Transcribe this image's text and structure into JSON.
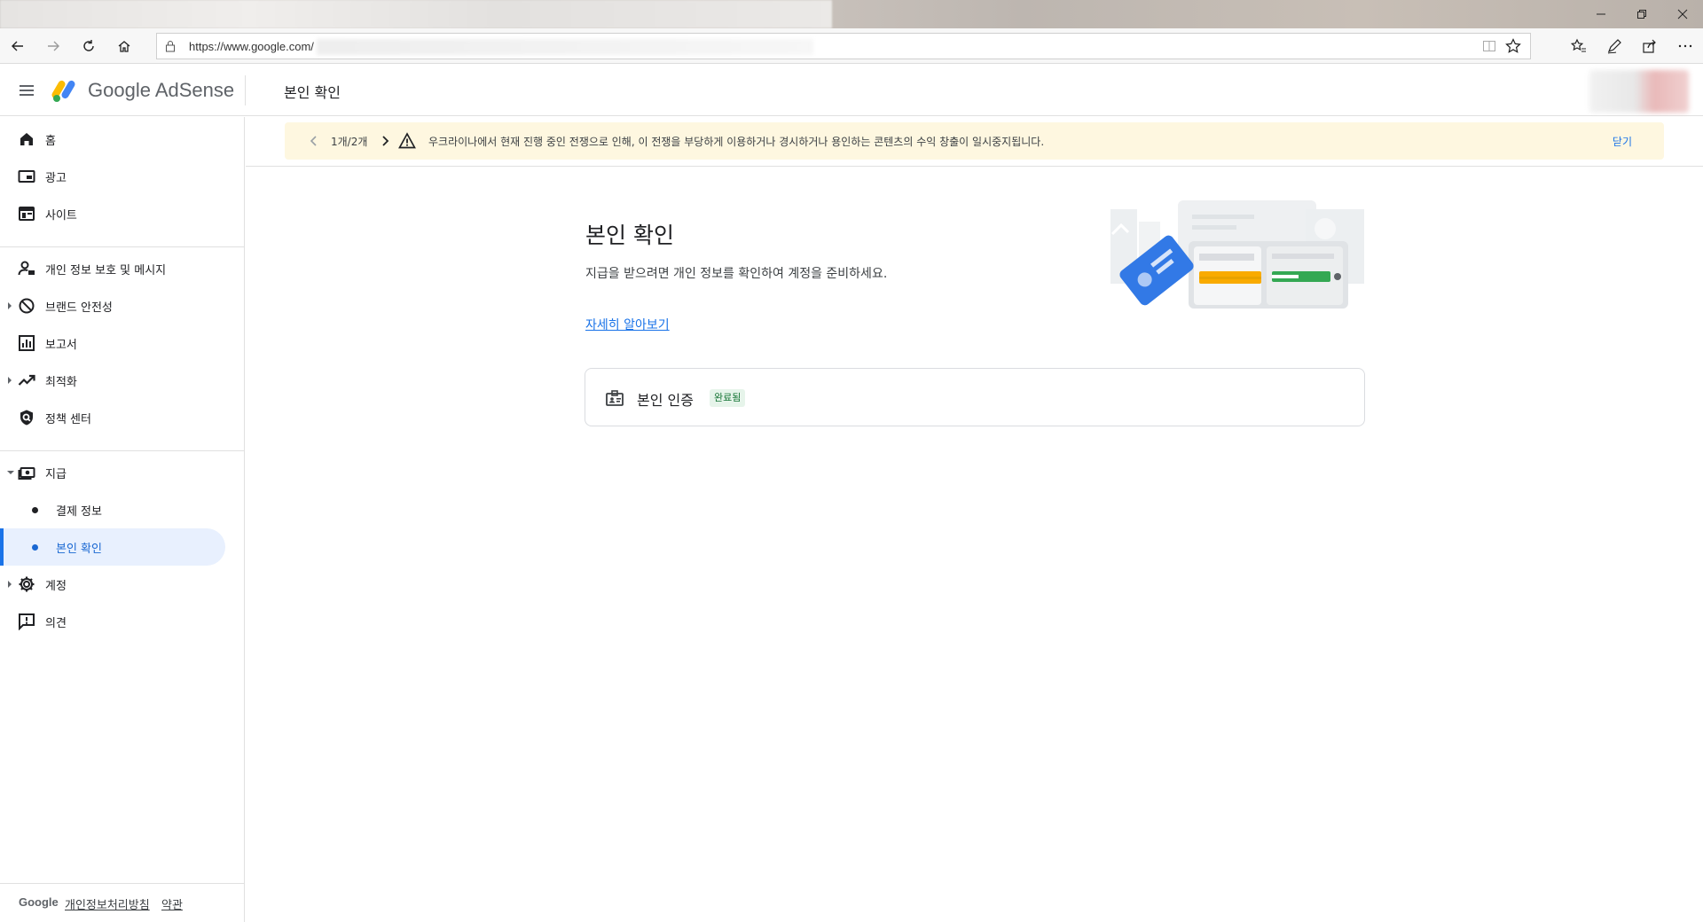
{
  "browser": {
    "url": "https://www.google.com/"
  },
  "app": {
    "logo_text": "Google AdSense",
    "header_title": "본인 확인"
  },
  "sidebar": {
    "items": [
      {
        "label": "홈",
        "icon": "home-icon"
      },
      {
        "label": "광고",
        "icon": "ads-icon"
      },
      {
        "label": "사이트",
        "icon": "sites-icon"
      },
      {
        "label": "개인 정보 보호 및 메시지",
        "icon": "privacy-icon"
      },
      {
        "label": "브랜드 안전성",
        "icon": "block-icon"
      },
      {
        "label": "보고서",
        "icon": "report-icon"
      },
      {
        "label": "최적화",
        "icon": "trending-icon"
      },
      {
        "label": "정책 센터",
        "icon": "policy-icon"
      },
      {
        "label": "지급",
        "icon": "payments-icon"
      },
      {
        "label": "계정",
        "icon": "gear-icon"
      },
      {
        "label": "의견",
        "icon": "feedback-icon"
      }
    ],
    "payments_sub": [
      {
        "label": "결제 정보"
      },
      {
        "label": "본인 확인"
      }
    ],
    "footer": {
      "brand": "Google",
      "privacy": "개인정보처리방침",
      "terms": "약관"
    }
  },
  "banner": {
    "count": "1개/2개",
    "message": "우크라이나에서 현재 진행 중인 전쟁으로 인해, 이 전쟁을 부당하게 이용하거나 경시하거나 용인하는 콘텐츠의 수익 창출이 일시중지됩니다.",
    "close": "닫기"
  },
  "main": {
    "title": "본인 확인",
    "description": "지급을 받으려면 개인 정보를 확인하여 계정을 준비하세요.",
    "learn_more": "자세히 알아보기",
    "card": {
      "label": "본인 인증",
      "status": "완료됨"
    }
  },
  "colors": {
    "accent": "#1a73e8",
    "active_bg": "#e8f0fe",
    "banner_bg": "#fef7e0",
    "success_bg": "#e6f4ea",
    "success_text": "#137333"
  }
}
